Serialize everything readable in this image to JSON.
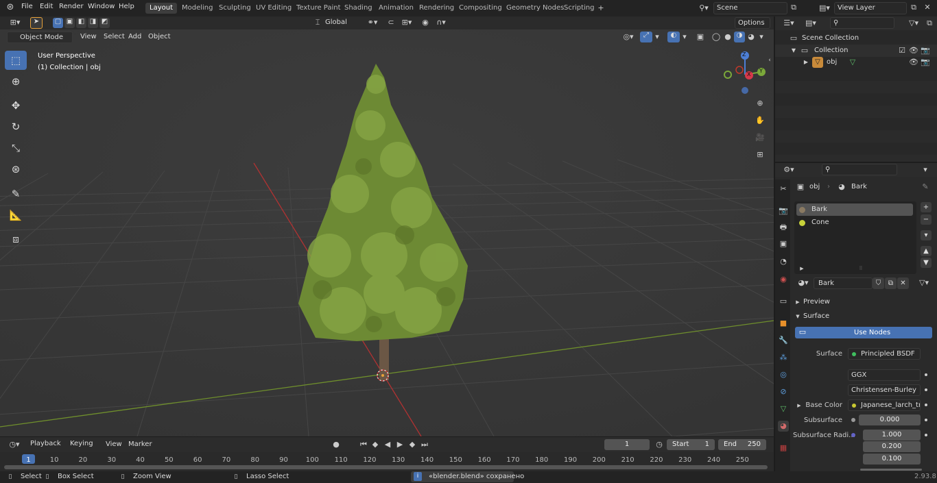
{
  "menu": [
    "File",
    "Edit",
    "Render",
    "Window",
    "Help"
  ],
  "workspaces": [
    "Layout",
    "Modeling",
    "Sculpting",
    "UV Editing",
    "Texture Paint",
    "Shading",
    "Animation",
    "Rendering",
    "Compositing",
    "Geometry Nodes",
    "Scripting"
  ],
  "scene": "Scene",
  "view_layer": "View Layer",
  "header": {
    "transform": "Global",
    "options": "Options",
    "mode": "Object Mode",
    "view": "View",
    "select": "Select",
    "add": "Add",
    "object": "Object"
  },
  "viewport": {
    "persp": "User Perspective",
    "collection": "(1) Collection | obj"
  },
  "gizmo": {
    "x": "X",
    "y": "Y",
    "z": "Z"
  },
  "outliner": {
    "scene_collection": "Scene Collection",
    "collection": "Collection",
    "obj": "obj"
  },
  "props": {
    "breadcrumb_obj": "obj",
    "breadcrumb_mat": "Bark",
    "slots": [
      "Bark",
      "Cone"
    ],
    "material_name": "Bark",
    "preview": "Preview",
    "surface": "Surface",
    "use_nodes": "Use Nodes",
    "surface_label": "Surface",
    "surface_value": "Principled BSDF",
    "dist": "GGX",
    "sss_method": "Christensen-Burley",
    "base_color_label": "Base Color",
    "base_color_value": "Japanese_larch_tree...",
    "subsurface_label": "Subsurface",
    "subsurface_value": "0.000",
    "subsurface_radius_label": "Subsurface Radi...",
    "radius": [
      "1.000",
      "0.200",
      "0.100"
    ]
  },
  "timeline": {
    "playback": "Playback",
    "keying": "Keying",
    "view": "View",
    "marker": "Marker",
    "current": "1",
    "start_label": "Start",
    "start": "1",
    "end_label": "End",
    "end": "250",
    "frames": [
      "1",
      "10",
      "20",
      "30",
      "40",
      "50",
      "60",
      "70",
      "80",
      "90",
      "100",
      "110",
      "120",
      "130",
      "140",
      "150",
      "160",
      "170",
      "180",
      "190",
      "200",
      "210",
      "220",
      "230",
      "240",
      "250"
    ]
  },
  "status": {
    "select": "Select",
    "box_select": "Box Select",
    "zoom_view": "Zoom View",
    "lasso_select": "Lasso Select",
    "message": "«blender.blend» сохранено",
    "version": "2.93.8"
  },
  "colors": {
    "accent": "#4772b3",
    "x_axis": "#c0392b",
    "y_axis": "#7ba83a",
    "tree": "#7a9a3a"
  }
}
